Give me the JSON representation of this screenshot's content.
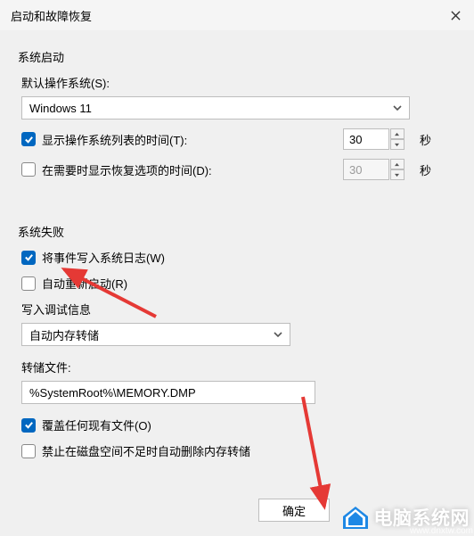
{
  "window": {
    "title": "启动和故障恢复"
  },
  "startup": {
    "group_title": "系统启动",
    "default_os_label": "默认操作系统(S):",
    "default_os_value": "Windows 11",
    "show_os_list": {
      "label": "显示操作系统列表的时间(T):",
      "checked": true,
      "value": "30",
      "unit": "秒"
    },
    "show_recovery": {
      "label": "在需要时显示恢复选项的时间(D):",
      "checked": false,
      "value": "30",
      "unit": "秒"
    }
  },
  "failure": {
    "group_title": "系统失败",
    "write_log": {
      "label": "将事件写入系统日志(W)",
      "checked": true
    },
    "auto_restart": {
      "label": "自动重新启动(R)",
      "checked": false
    },
    "debug_label": "写入调试信息",
    "debug_value": "自动内存转储",
    "dump_file_label": "转储文件:",
    "dump_file_value": "%SystemRoot%\\MEMORY.DMP",
    "overwrite": {
      "label": "覆盖任何现有文件(O)",
      "checked": true
    },
    "no_delete": {
      "label": "禁止在磁盘空间不足时自动删除内存转储",
      "checked": false
    }
  },
  "buttons": {
    "ok": "确定"
  },
  "watermark": {
    "text": "电脑系统网",
    "url": "www.dnxtw.com"
  }
}
